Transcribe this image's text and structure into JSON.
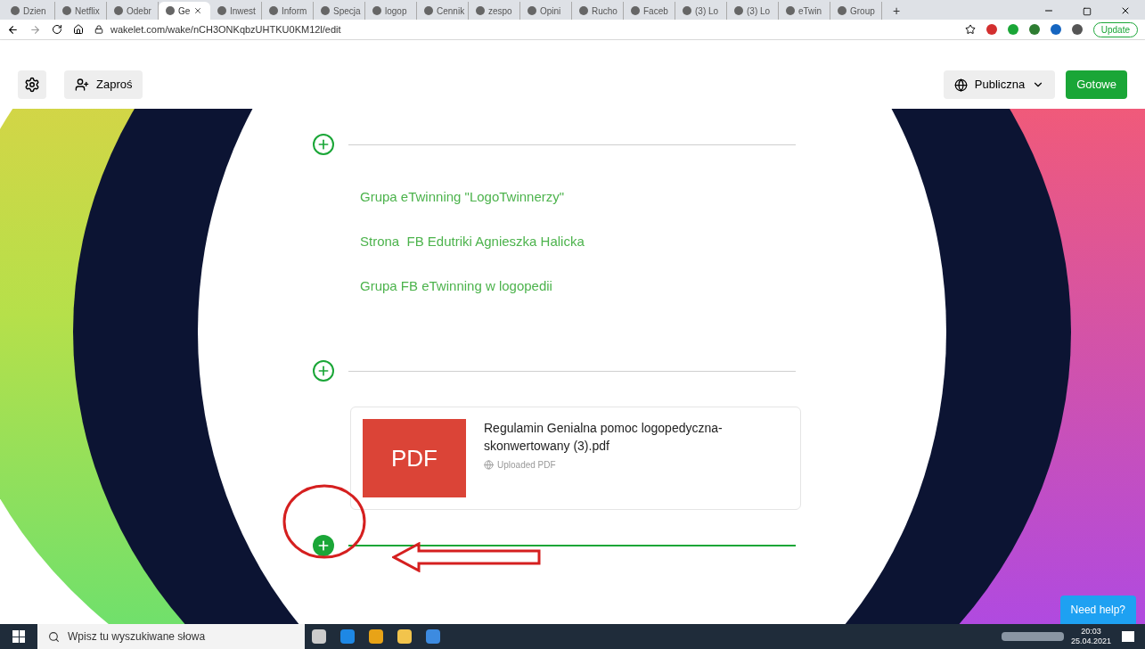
{
  "browser": {
    "tabs": [
      {
        "label": "Dzien",
        "selected": false
      },
      {
        "label": "Netflix",
        "selected": false
      },
      {
        "label": "Odebr",
        "selected": false
      },
      {
        "label": "Ge",
        "selected": true
      },
      {
        "label": "Inwest",
        "selected": false
      },
      {
        "label": "Inform",
        "selected": false
      },
      {
        "label": "Specja",
        "selected": false
      },
      {
        "label": "logop",
        "selected": false
      },
      {
        "label": "Cennik",
        "selected": false
      },
      {
        "label": "zespo",
        "selected": false
      },
      {
        "label": "Opini",
        "selected": false
      },
      {
        "label": "Rucho",
        "selected": false
      },
      {
        "label": "Faceb",
        "selected": false
      },
      {
        "label": "(3) Lo",
        "selected": false
      },
      {
        "label": "(3) Lo",
        "selected": false
      },
      {
        "label": "eTwin",
        "selected": false
      },
      {
        "label": "Group",
        "selected": false
      }
    ],
    "new_tab": "+",
    "address": "wakelet.com/wake/nCH3ONKqbzUHTKU0KM12l/edit",
    "update_button": "Update"
  },
  "toolbar": {
    "invite_button": "Zaproś",
    "visibility_button": "Publiczna",
    "done_button": "Gotowe"
  },
  "content": [
    {
      "kind": "divider",
      "active": false
    },
    {
      "kind": "link",
      "text": "Grupa eTwinning \"LogoTwinnerzy\""
    },
    {
      "kind": "link",
      "text": "Strona  FB Edutriki Agnieszka Halicka"
    },
    {
      "kind": "link",
      "text": "Grupa FB eTwinning w logopedii"
    },
    {
      "kind": "divider",
      "active": false
    },
    {
      "kind": "pdf",
      "thumb": "PDF",
      "title": "Regulamin Genialna pomoc logopedyczna-skonwertowany (3).pdf",
      "source": "Uploaded PDF"
    },
    {
      "kind": "divider",
      "active": true
    }
  ],
  "help_button": "Need help?",
  "taskbar": {
    "search_placeholder": "Wpisz tu wyszukiwane słowa",
    "time": "20:03",
    "date": "25.04.2021"
  }
}
